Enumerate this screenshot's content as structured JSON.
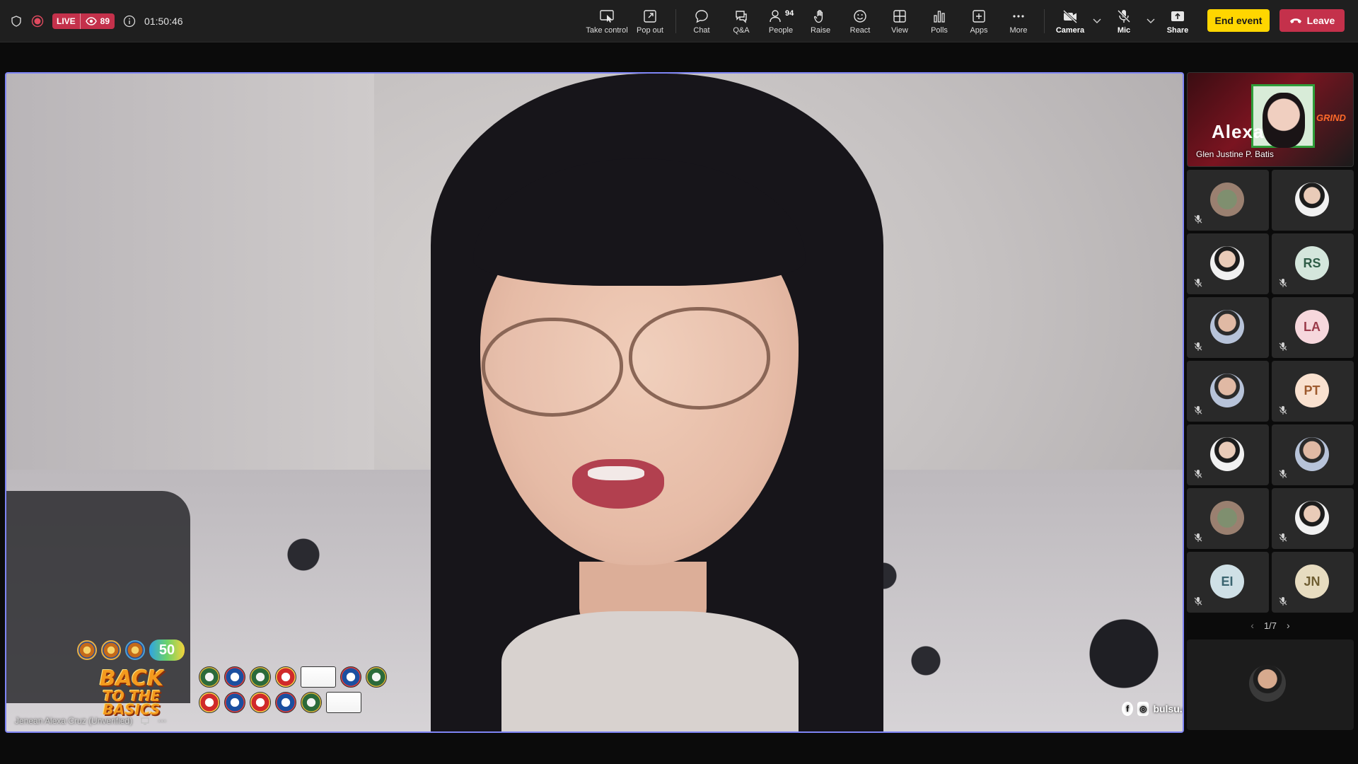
{
  "status": {
    "live_label": "LIVE",
    "viewer_count": "89",
    "elapsed_time": "01:50:46"
  },
  "toolbar": {
    "take_control": "Take control",
    "pop_out": "Pop out",
    "chat": "Chat",
    "qa": "Q&A",
    "people": "People",
    "people_count": "94",
    "raise": "Raise",
    "react": "React",
    "view": "View",
    "polls": "Polls",
    "apps": "Apps",
    "more": "More",
    "camera": "Camera",
    "mic": "Mic",
    "share": "Share",
    "end_event": "End event",
    "leave": "Leave"
  },
  "stage": {
    "speaker_name": "Jenean Alexa Cruz (Unverified)",
    "overlay_title_line1": "BACK",
    "overlay_title_line2": "TO THE BASICS",
    "overlay_badge": "50",
    "social_handle_1": "bulsu.officialmsc",
    "social_handle_2": "bulsu-msc"
  },
  "featured": {
    "banner_text": "Alexa",
    "banner_tag": "GRIND",
    "participant_name": "Glen Justine P. Batis"
  },
  "participants": [
    {
      "initials": "",
      "kind": "photo3"
    },
    {
      "initials": "",
      "kind": "photo"
    },
    {
      "initials": "",
      "kind": "photo"
    },
    {
      "initials": "RS",
      "kind": "rs"
    },
    {
      "initials": "",
      "kind": "photo2"
    },
    {
      "initials": "LA",
      "kind": "la"
    },
    {
      "initials": "",
      "kind": "photo2"
    },
    {
      "initials": "PT",
      "kind": "pt"
    },
    {
      "initials": "",
      "kind": "photo"
    },
    {
      "initials": "",
      "kind": "photo2"
    },
    {
      "initials": "",
      "kind": "photo3"
    },
    {
      "initials": "",
      "kind": "photo"
    },
    {
      "initials": "EI",
      "kind": "ei"
    },
    {
      "initials": "JN",
      "kind": "jn"
    }
  ],
  "pager": {
    "label": "1/7"
  },
  "colors": {
    "accent_border": "#7f85f5",
    "live_red": "#c4314b",
    "end_event_yellow": "#ffd600"
  }
}
